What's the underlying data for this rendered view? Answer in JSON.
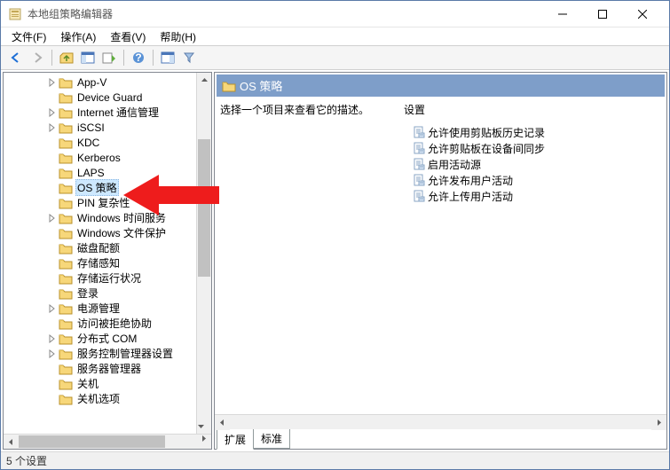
{
  "window": {
    "title": "本地组策略编辑器"
  },
  "menus": [
    "文件(F)",
    "操作(A)",
    "查看(V)",
    "帮助(H)"
  ],
  "tree": {
    "items": [
      {
        "label": "App-V",
        "exp": "closed"
      },
      {
        "label": "Device Guard",
        "exp": "none"
      },
      {
        "label": "Internet 通信管理",
        "exp": "closed"
      },
      {
        "label": "iSCSI",
        "exp": "closed"
      },
      {
        "label": "KDC",
        "exp": "none"
      },
      {
        "label": "Kerberos",
        "exp": "none"
      },
      {
        "label": "LAPS",
        "exp": "none"
      },
      {
        "label": "OS 策略",
        "exp": "none",
        "selected": true
      },
      {
        "label": "PIN 复杂性",
        "exp": "none"
      },
      {
        "label": "Windows 时间服务",
        "exp": "closed"
      },
      {
        "label": "Windows 文件保护",
        "exp": "none"
      },
      {
        "label": "磁盘配额",
        "exp": "none"
      },
      {
        "label": "存储感知",
        "exp": "none"
      },
      {
        "label": "存储运行状况",
        "exp": "none"
      },
      {
        "label": "登录",
        "exp": "none"
      },
      {
        "label": "电源管理",
        "exp": "closed"
      },
      {
        "label": "访问被拒绝协助",
        "exp": "none"
      },
      {
        "label": "分布式 COM",
        "exp": "closed"
      },
      {
        "label": "服务控制管理器设置",
        "exp": "closed"
      },
      {
        "label": "服务器管理器",
        "exp": "none"
      },
      {
        "label": "关机",
        "exp": "none"
      },
      {
        "label": "关机选项",
        "exp": "none"
      }
    ]
  },
  "detail": {
    "header": "OS 策略",
    "description": "选择一个项目来查看它的描述。",
    "column_header": "设置",
    "settings": [
      "允许使用剪贴板历史记录",
      "允许剪贴板在设备间同步",
      "启用活动源",
      "允许发布用户活动",
      "允许上传用户活动"
    ]
  },
  "tabs": [
    "扩展",
    "标准"
  ],
  "status": "5 个设置"
}
